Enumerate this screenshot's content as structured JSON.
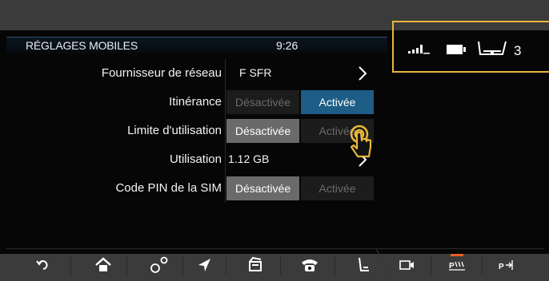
{
  "header": {
    "title": "RÉGLAGES MOBILES",
    "time": "9:26"
  },
  "status_icons": [
    "signal-icon",
    "battery-icon",
    "seat-icon",
    "seat-icon"
  ],
  "status_partial_digit": "3",
  "rows": [
    {
      "label": "Fournisseur de réseau",
      "value": "F SFR"
    },
    {
      "label": "Itinérance",
      "off": "Désactivée",
      "on": "Activée"
    },
    {
      "label": "Limite d'utilisation",
      "off": "Désactivée",
      "on": "Activée"
    },
    {
      "label": "Utilisation",
      "value": "1.12 GB"
    },
    {
      "label": "Code PIN de la SIM",
      "off": "Désactivée",
      "on": "Activée"
    }
  ],
  "nav": {
    "items": [
      "back-icon",
      "home-icon",
      "connections-icon",
      "navigation-icon",
      "media-icon",
      "phone-icon",
      "seat-icon",
      "camera-icon",
      "park-assist-icon",
      "park-exit-icon"
    ],
    "park_assist_label": "P",
    "park_exit_label": "P"
  },
  "colors": {
    "accent": "#1d5d86",
    "highlight_border": "#e9b73b",
    "selected_grey": "#6a6a6a",
    "nav_bar_accent": "#e8601c"
  }
}
